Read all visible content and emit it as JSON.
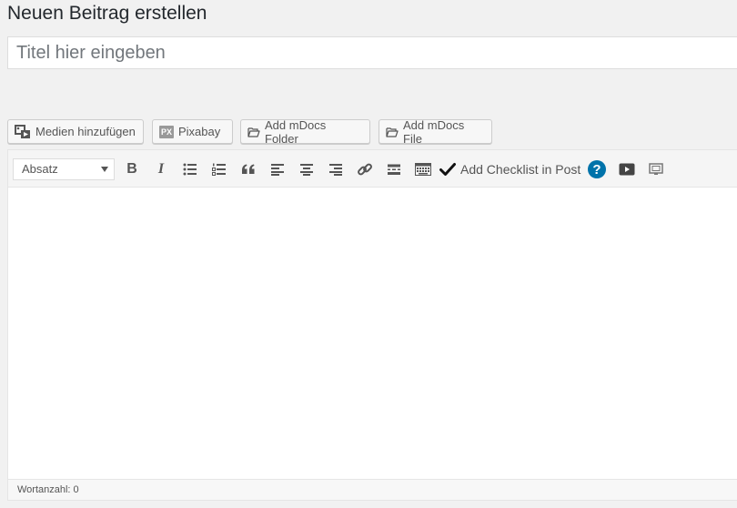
{
  "page": {
    "title": "Neuen Beitrag erstellen"
  },
  "title_field": {
    "placeholder": "Titel hier eingeben",
    "value": ""
  },
  "media_buttons": {
    "add_media": "Medien hinzufügen",
    "pixabay": "Pixabay",
    "pixabay_badge": "PX",
    "add_mdocs_folder": "Add mDocs Folder",
    "add_mdocs_file": "Add mDocs File"
  },
  "toolbar": {
    "format_select": "Absatz",
    "bold": "B",
    "italic": "I",
    "checklist_label": "Add Checklist in Post",
    "help": "?"
  },
  "status_bar": {
    "word_count": "Wortanzahl: 0"
  },
  "colors": {
    "help_blue": "#0073aa",
    "icon_gray": "#555555"
  }
}
